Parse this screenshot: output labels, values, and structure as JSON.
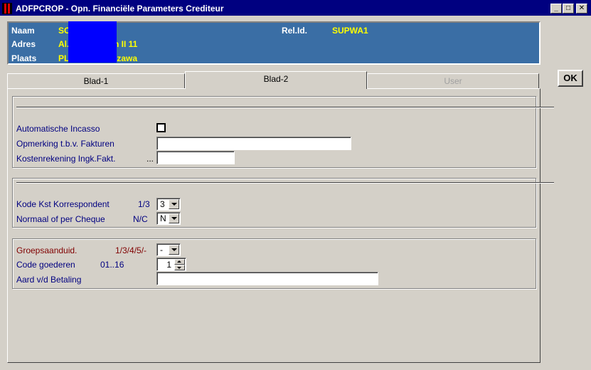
{
  "window": {
    "title": "ADFPCROP - Opn. Financiële Parameters Crediteur",
    "minimize_glyph": "_",
    "maximize_glyph": "□",
    "close_glyph": "✕"
  },
  "header": {
    "naam_label": "Naam",
    "naam_value": "SC",
    "adres_label": "Adres",
    "adres_value_start": "Al.",
    "adres_value_end": "n II 11",
    "plaats_label": "Plaats",
    "plaats_value_start": "PL-0",
    "plaats_value_end": "rszawa",
    "relid_label": "Rel.Id.",
    "relid_value": "SUPWA1",
    "redaction_color": "#0000ff"
  },
  "ok_button": "OK",
  "tabs": [
    {
      "label": "Blad-1",
      "active": false,
      "enabled": true
    },
    {
      "label": "Blad-2",
      "active": true,
      "enabled": true
    },
    {
      "label": "User",
      "active": false,
      "enabled": false
    }
  ],
  "group1": {
    "automatische_incasso_label": "Automatische Incasso",
    "automatische_incasso_checked": false,
    "opmerking_label": "Opmerking t.b.v. Fakturen",
    "opmerking_value": "",
    "kostenrekening_label": "Kostenrekening Ingk.Fakt.",
    "kostenrekening_lookup": "...",
    "kostenrekening_value": ""
  },
  "group2": {
    "kode_kst_label": "Kode Kst Korrespondent",
    "kode_kst_hint": "1/3",
    "kode_kst_value": "3",
    "normaal_label": "Normaal of per Cheque",
    "normaal_hint": "N/C",
    "normaal_value": "N"
  },
  "group3": {
    "groepsaanduid_label": "Groepsaanduid.",
    "groepsaanduid_hint": "1/3/4/5/-",
    "groepsaanduid_value": "-",
    "code_goederen_label": "Code goederen",
    "code_goederen_hint": "01..16",
    "code_goederen_value": "1",
    "aard_label": "Aard v/d Betaling",
    "aard_value": ""
  },
  "colors": {
    "titlebar": "#000080",
    "header_panel": "#3a6ea5",
    "header_value": "#ffff00",
    "label": "#000080",
    "label_required": "#800000"
  }
}
